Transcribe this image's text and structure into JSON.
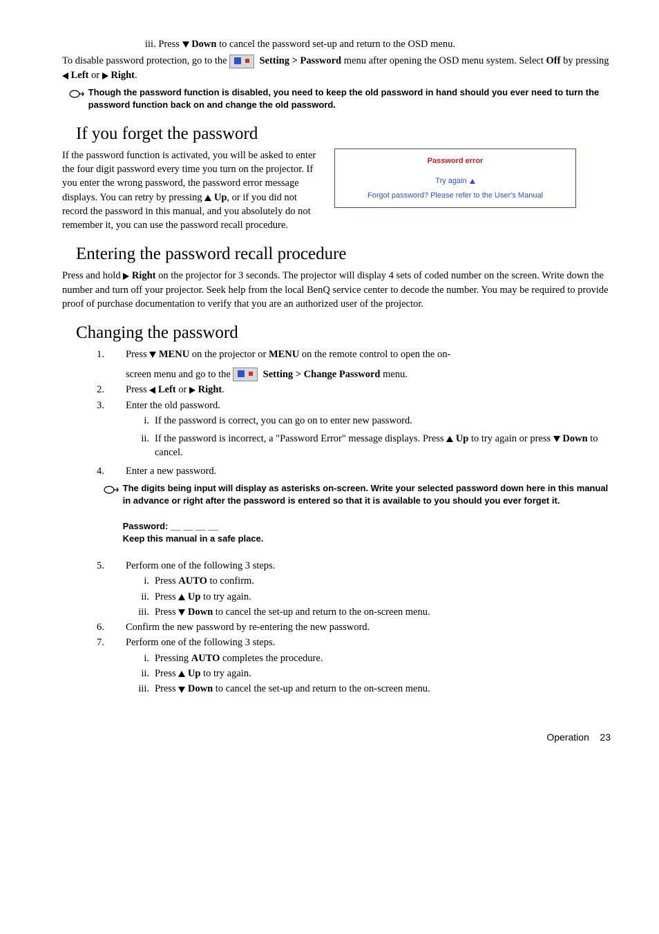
{
  "p_iii": "Down",
  "p_iii_text": " to cancel the password set-up and return to the OSD menu.",
  "p_iii_prefix": "iii.  Press ",
  "disable_1a": "To disable password protection, go to the ",
  "disable_1b": "Setting > Password",
  "disable_1c": " menu after opening the OSD menu system. Select ",
  "off": "Off",
  "disable_1d": " by pressing ",
  "left": " Left",
  "or": " or ",
  "right": " Right",
  "period": ".",
  "note1": "Though the password function is disabled, you need to keep the old password in hand should you ever need to turn the password function back on and change the old password.",
  "h_forget": "If you forget the password",
  "forget_body": "If the password function is activated, you will be asked to enter the four digit password every time you turn on the projector. If you enter the wrong password, the password error message displays. You can retry by pressing ",
  "up": " Up",
  "forget_body2": ", or if you did not record the password in this manual, and you absolutely do not remember it, you can use the password recall procedure.",
  "err_title": "Password error",
  "err_try": "Try again",
  "err_forgot": "Forgot password? Please refer to the User's Manual",
  "h_recall": "Entering the password recall procedure",
  "recall_body_a": "Press and hold ",
  "recall_body_b": " on the projector for 3 seconds. The projector will display 4 sets of coded number on the screen. Write down the number and turn off your projector. Seek help from the local BenQ service center to decode the number. You may be required to provide proof of purchase documentation to verify that you are an authorized user of the projector.",
  "h_change": "Changing the password",
  "c1a": "Press ",
  "menu": " MENU",
  "c1b": " on the projector or ",
  "menu2": "MENU",
  "c1c": " on the remote control to open the on-",
  "c1d": "screen menu and go to the ",
  "c1e": "Setting > Change Password",
  "c1f": " menu.",
  "c2": "Press ",
  "c3": "Enter the old password.",
  "c3i": "If the password is correct, you can go on to enter new password.",
  "c3iia": "If the password is incorrect, a \"Password Error\" message displays. Press ",
  "c3iib": " to try again or press ",
  "down": " Down",
  "c3iic": " to cancel.",
  "c4": "Enter a new password.",
  "note2a": "The digits being input will display as asterisks on-screen. Write your selected password down here in this manual in advance or right after the password is entered so that it is available to you should you ever forget it.",
  "note2b": "Password: __ __ __ __",
  "note2c": "Keep this manual in a safe place.",
  "c5": "Perform one of the following 3 steps.",
  "c5ia": "Press ",
  "auto": "AUTO",
  "c5ib": " to confirm.",
  "c5ii": " to try again.",
  "c5iii": " to cancel the set-up and return to the on-screen menu.",
  "c6": "Confirm the new password by re-entering the new password.",
  "c7": "Perform one of the following 3 steps.",
  "c7ia": "Pressing ",
  "c7ib": " completes the procedure.",
  "footer_a": "Operation",
  "footer_b": "23"
}
